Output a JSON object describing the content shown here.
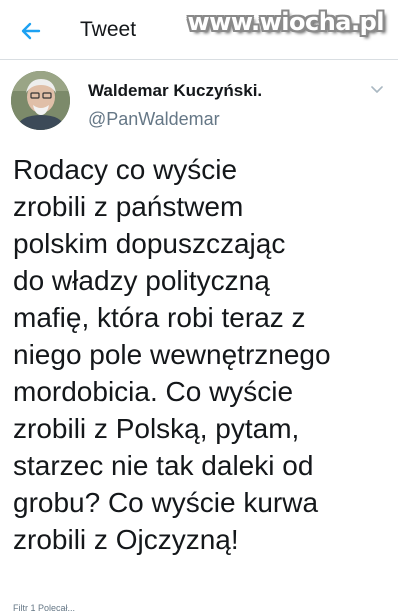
{
  "header": {
    "back_icon": "arrow-left-icon",
    "title": "Tweet",
    "watermark": "www.wiocha.pl"
  },
  "tweet": {
    "avatar": "avatar-photo",
    "display_name": "Waldemar Kuczyński.",
    "handle": "@PanWaldemar",
    "menu_icon": "chevron-down-icon",
    "text": "Rodacy co wyście\nzrobili z państwem\npolskim dopuszczając\ndo władzy polityczną\nmafię, która robi teraz z\nniego pole wewnętrznego\nmordobicia. Co wyście\nzrobili z Polską, pytam,\nstarzec nie tak daleki od\ngrobu? Co wyście kurwa\nzrobili z Ojczyzną!",
    "meta": "Filtr 1 Polecał..."
  },
  "colors": {
    "accent": "#1da1f2",
    "text": "#14171a",
    "secondary": "#657786"
  }
}
